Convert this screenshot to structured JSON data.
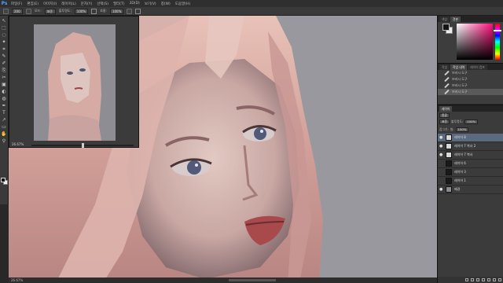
{
  "app": {
    "logo": "Ps"
  },
  "menu": [
    "파일(F)",
    "편집(E)",
    "이미지(I)",
    "레이어(L)",
    "문자(Y)",
    "선택(S)",
    "필터(T)",
    "3D(D)",
    "보기(V)",
    "창(W)",
    "도움말(H)"
  ],
  "options": {
    "size": "200",
    "mode": "표준",
    "opacity_label": "불투명도:",
    "opacity": "100%",
    "flow_label": "흐름:",
    "flow": "100%"
  },
  "tools": [
    "↖",
    "⬚",
    "◌",
    "✦",
    "⌗",
    "✎",
    "✐",
    "⎘",
    "✂",
    "▣",
    "◐",
    "◍",
    "✒",
    "T",
    "↗",
    "▭",
    "✋",
    "⚲"
  ],
  "navigator": {
    "zoom": "26.67%"
  },
  "color_panel": {
    "tabs": [
      "색상",
      "견본"
    ]
  },
  "history_panel": {
    "tabs": [
      "작업",
      "작업 내역",
      "레이어 컴프"
    ],
    "items": [
      "브러시 도구",
      "브러시 도구",
      "브러시 도구",
      "브러시 도구"
    ]
  },
  "layers_panel": {
    "tabs": [
      "레이어"
    ],
    "kind": "종류",
    "blend": "표준",
    "opacity_label": "불투명도:",
    "opacity": "100%",
    "lock_label": "잠그기:",
    "fill_label": "칠:",
    "fill": "100%",
    "layers": [
      {
        "name": "레이어 8",
        "thumb": "light",
        "active": true
      },
      {
        "name": "레이어 7 복사 2",
        "thumb": "light",
        "active": false
      },
      {
        "name": "레이어 7 복사",
        "thumb": "light",
        "active": false
      },
      {
        "name": "레이어 6",
        "thumb": "dark",
        "active": false
      },
      {
        "name": "레이어 3",
        "thumb": "dark",
        "active": false
      },
      {
        "name": "레이어 1",
        "thumb": "dark",
        "active": false
      },
      {
        "name": "배경",
        "thumb": "grey",
        "active": false
      }
    ]
  },
  "status": {
    "zoom": "26.67%"
  },
  "colors": {
    "foreground": "#151515",
    "background": "#ececec",
    "canvas_bg": "#9a989f"
  }
}
